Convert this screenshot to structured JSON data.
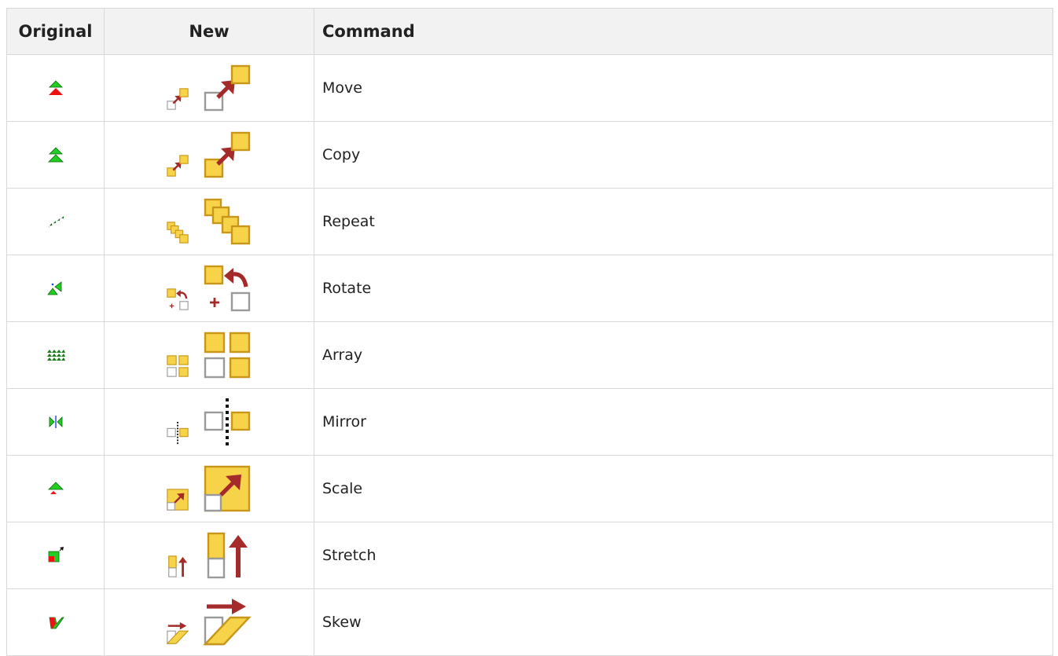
{
  "table": {
    "headers": {
      "original": "Original",
      "new": "New",
      "command": "Command"
    },
    "rows": [
      {
        "command": "Move",
        "original_icon": "move-original-icon",
        "new_icon": "move-new-icon"
      },
      {
        "command": "Copy",
        "original_icon": "copy-original-icon",
        "new_icon": "copy-new-icon"
      },
      {
        "command": "Repeat",
        "original_icon": "repeat-original-icon",
        "new_icon": "repeat-new-icon"
      },
      {
        "command": "Rotate",
        "original_icon": "rotate-original-icon",
        "new_icon": "rotate-new-icon"
      },
      {
        "command": "Array",
        "original_icon": "array-original-icon",
        "new_icon": "array-new-icon"
      },
      {
        "command": "Mirror",
        "original_icon": "mirror-original-icon",
        "new_icon": "mirror-new-icon"
      },
      {
        "command": "Scale",
        "original_icon": "scale-original-icon",
        "new_icon": "scale-new-icon"
      },
      {
        "command": "Stretch",
        "original_icon": "stretch-original-icon",
        "new_icon": "stretch-new-icon"
      },
      {
        "command": "Skew",
        "original_icon": "skew-original-icon",
        "new_icon": "skew-new-icon"
      }
    ]
  },
  "colors": {
    "header_bg": "#f2f2f2",
    "border": "#d8d8d8",
    "icon_yellow": "#f7d34a",
    "icon_yellow_stroke": "#c8961a",
    "icon_red_arrow": "#a52a2a",
    "icon_green": "#22cc22",
    "icon_red": "#ee1111"
  }
}
